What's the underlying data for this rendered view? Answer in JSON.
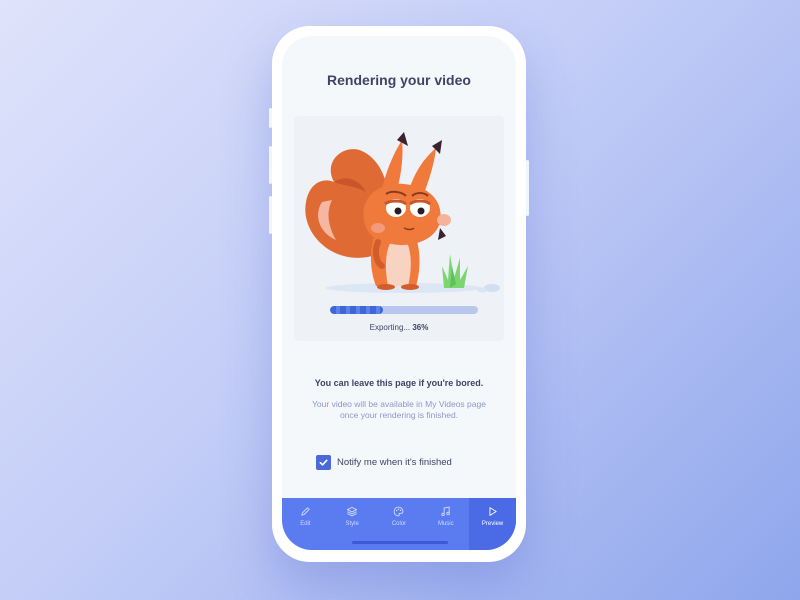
{
  "header": {
    "title": "Rendering your video"
  },
  "progress": {
    "label": "Exporting... ",
    "percent_text": "36%",
    "value": 0.36
  },
  "message": {
    "headline": "You can leave this page if you're bored.",
    "detail": "Your video will be available in My Videos page once your rendering is finished."
  },
  "notify": {
    "label": "Notify me when it's finished",
    "checked": true
  },
  "tabs": [
    {
      "label": "Edit",
      "icon": "pencil-icon",
      "active": false
    },
    {
      "label": "Style",
      "icon": "layers-icon",
      "active": false
    },
    {
      "label": "Color",
      "icon": "palette-icon",
      "active": false
    },
    {
      "label": "Music",
      "icon": "music-note-icon",
      "active": false
    },
    {
      "label": "Preview",
      "icon": "play-icon",
      "active": true
    }
  ],
  "colors": {
    "accent": "#5a7cf0",
    "accent_active": "#4a6ae6",
    "progress_fill": "#3d67d8",
    "progress_track": "#b9c7ef",
    "text": "#3f4466",
    "muted_text": "#8e96c8"
  }
}
